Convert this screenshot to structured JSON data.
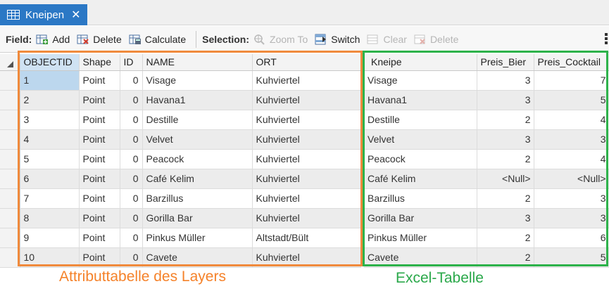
{
  "tab": {
    "title": "Kneipen",
    "close": "✕"
  },
  "toolbar": {
    "field_label": "Field:",
    "add": "Add",
    "delete": "Delete",
    "calculate": "Calculate",
    "selection_label": "Selection:",
    "zoom_to": "Zoom To",
    "switch": "Switch",
    "clear": "Clear",
    "sel_delete": "Delete"
  },
  "attribute_table": {
    "columns": [
      "OBJECTID",
      "Shape",
      "ID",
      "NAME",
      "ORT"
    ],
    "rows": [
      [
        "1",
        "Point",
        "0",
        "Visage",
        "Kuhviertel"
      ],
      [
        "2",
        "Point",
        "0",
        "Havana1",
        "Kuhviertel"
      ],
      [
        "3",
        "Point",
        "0",
        "Destille",
        "Kuhviertel"
      ],
      [
        "4",
        "Point",
        "0",
        "Velvet",
        "Kuhviertel"
      ],
      [
        "5",
        "Point",
        "0",
        "Peacock",
        "Kuhviertel"
      ],
      [
        "6",
        "Point",
        "0",
        "Café Kelim",
        "Kuhviertel"
      ],
      [
        "7",
        "Point",
        "0",
        "Barzillus",
        "Kuhviertel"
      ],
      [
        "8",
        "Point",
        "0",
        "Gorilla Bar",
        "Kuhviertel"
      ],
      [
        "9",
        "Point",
        "0",
        "Pinkus Müller",
        "Altstadt/Bült"
      ],
      [
        "10",
        "Point",
        "0",
        "Cavete",
        "Kuhviertel"
      ]
    ]
  },
  "excel_table": {
    "columns": [
      "Kneipe",
      "Preis_Bier",
      "Preis_Cocktail"
    ],
    "rows": [
      [
        "Visage",
        "3",
        "7"
      ],
      [
        "Havana1",
        "3",
        "5"
      ],
      [
        "Destille",
        "2",
        "4"
      ],
      [
        "Velvet",
        "3",
        "3"
      ],
      [
        "Peacock",
        "2",
        "4"
      ],
      [
        "Café Kelim",
        "<Null>",
        "<Null>"
      ],
      [
        "Barzillus",
        "2",
        "3"
      ],
      [
        "Gorilla Bar",
        "3",
        "3"
      ],
      [
        "Pinkus Müller",
        "2",
        "6"
      ],
      [
        "Cavete",
        "2",
        "5"
      ]
    ]
  },
  "captions": {
    "attribute": "Attributtabelle des Layers",
    "excel": "Excel-Tabelle"
  },
  "colors": {
    "tab": "#2b78c5",
    "orange_box": "#f08a3c",
    "green_box": "#2db24a"
  }
}
